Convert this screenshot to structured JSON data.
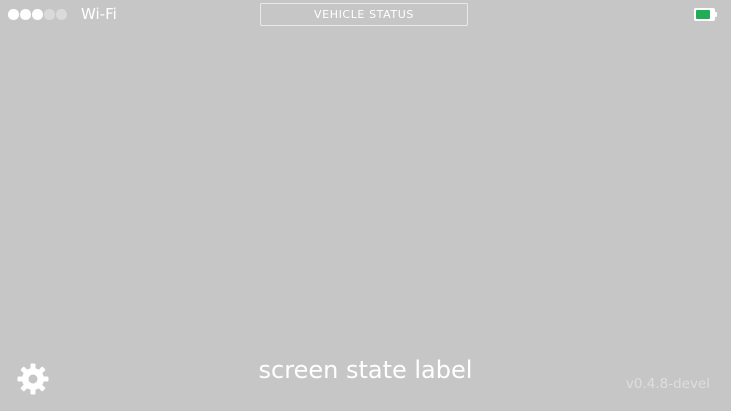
{
  "status_bar": {
    "signal_strength_filled": 3,
    "signal_strength_total": 5,
    "network_label": "Wi-Fi",
    "vehicle_status_label": "VEHICLE STATUS",
    "battery_level": 0.85,
    "battery_color": "#1fae55"
  },
  "main": {
    "screen_state_label": "screen state label",
    "settings_icon": "gear-icon"
  },
  "footer": {
    "version_label": "v0.4.8-devel"
  },
  "colors": {
    "background": "#c6c6c6",
    "text": "#ffffff",
    "version_text": "#dedede"
  }
}
